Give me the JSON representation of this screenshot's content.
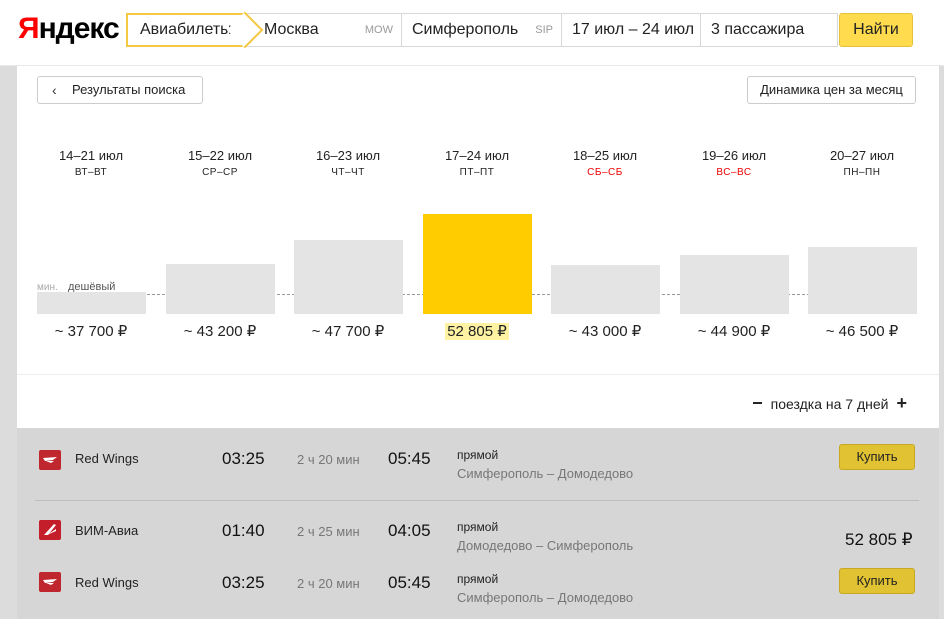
{
  "header": {
    "logo_first": "Я",
    "logo_rest": "ндекс",
    "tab_avia": "Авиабилеты",
    "from_city": "Москва",
    "from_code": "MOW",
    "to_city": "Симферополь",
    "to_code": "SIP",
    "dates": "17 июл – 24 июл",
    "passengers": "3 пассажира",
    "find_label": "Найти"
  },
  "panel": {
    "back_label": "Результаты поиска",
    "back_icon": "chevron-left-icon",
    "dynamics_label": "Динамика цен за месяц",
    "min_label": "мин.",
    "cheap_label": "дешёвый",
    "trip_label": "поездка на 7 дней",
    "minus": "−",
    "plus": "+"
  },
  "columns": [
    {
      "range": "14–21 июл",
      "days": "ВТ–ВТ",
      "weekend": false,
      "price": "~ 37 700 ₽",
      "value": 37700,
      "selected": false
    },
    {
      "range": "15–22 июл",
      "days": "СР–СР",
      "weekend": false,
      "price": "~ 43 200 ₽",
      "value": 43200,
      "selected": false
    },
    {
      "range": "16–23 июл",
      "days": "ЧТ–ЧТ",
      "weekend": false,
      "price": "~ 47 700 ₽",
      "value": 47700,
      "selected": false
    },
    {
      "range": "17–24 июл",
      "days": "ПТ–ПТ",
      "weekend": false,
      "price": "52 805 ₽",
      "value": 52805,
      "selected": true
    },
    {
      "range": "18–25 июл",
      "days": "СБ–СБ",
      "weekend": true,
      "price": "~ 43 000 ₽",
      "value": 43000,
      "selected": false
    },
    {
      "range": "19–26 июл",
      "days": "ВС–ВС",
      "weekend": true,
      "price": "~ 44 900 ₽",
      "value": 44900,
      "selected": false
    },
    {
      "range": "20–27 июл",
      "days": "ПН–ПН",
      "weekend": false,
      "price": "~ 46 500 ₽",
      "value": 46500,
      "selected": false
    }
  ],
  "flights": [
    {
      "airline": "Red Wings",
      "dep": "03:25",
      "dur": "2 ч 20 мин",
      "arr": "05:45",
      "type": "прямой",
      "route": "Симферополь – Домодедово",
      "buy": "Купить"
    },
    {
      "airline": "ВИМ-Авиа",
      "dep": "01:40",
      "dur": "2 ч 25 мин",
      "arr": "04:05",
      "type": "прямой",
      "route": "Домодедово – Симферополь"
    },
    {
      "airline": "Red Wings",
      "dep": "03:25",
      "dur": "2 ч 20 мин",
      "arr": "05:45",
      "type": "прямой",
      "route": "Симферополь – Домодедово",
      "buy": "Купить"
    }
  ],
  "total_price": "52 805 ₽",
  "colors": {
    "accent": "#ffcc00",
    "bar": "#e4e4e4",
    "weekend": "#e00000",
    "buy": "#e0c232"
  }
}
